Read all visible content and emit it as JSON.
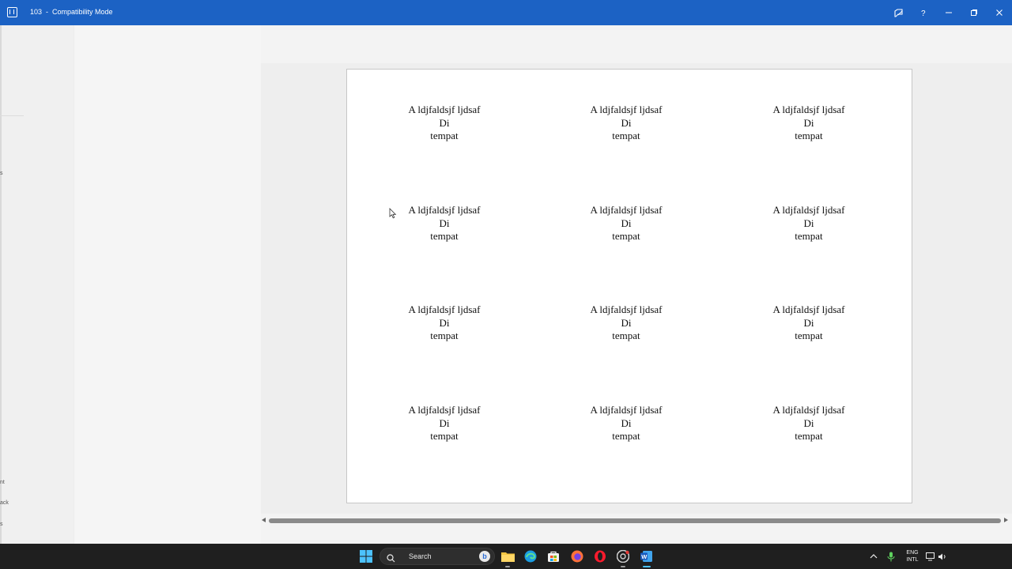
{
  "titlebar": {
    "doc_name": "103",
    "separator": "-",
    "mode": "Compatibility Mode",
    "colors": {
      "background": "#1c62c4"
    }
  },
  "left_panel": {
    "items": [
      "s",
      "nt",
      "ack",
      "s"
    ]
  },
  "document": {
    "labels": [
      {
        "line1": "A ldjfaldsjf ljdsaf",
        "line2": "Di",
        "line3": "tempat"
      },
      {
        "line1": "A ldjfaldsjf ljdsaf",
        "line2": "Di",
        "line3": "tempat"
      },
      {
        "line1": "A ldjfaldsjf ljdsaf",
        "line2": "Di",
        "line3": "tempat"
      },
      {
        "line1": "A ldjfaldsjf ljdsaf",
        "line2": "Di",
        "line3": "tempat"
      },
      {
        "line1": "A ldjfaldsjf ljdsaf",
        "line2": "Di",
        "line3": "tempat"
      },
      {
        "line1": "A ldjfaldsjf ljdsaf",
        "line2": "Di",
        "line3": "tempat"
      },
      {
        "line1": "A ldjfaldsjf ljdsaf",
        "line2": "Di",
        "line3": "tempat"
      },
      {
        "line1": "A ldjfaldsjf ljdsaf",
        "line2": "Di",
        "line3": "tempat"
      },
      {
        "line1": "A ldjfaldsjf ljdsaf",
        "line2": "Di",
        "line3": "tempat"
      },
      {
        "line1": "A ldjfaldsjf ljdsaf",
        "line2": "Di",
        "line3": "tempat"
      },
      {
        "line1": "A ldjfaldsjf ljdsaf",
        "line2": "Di",
        "line3": "tempat"
      },
      {
        "line1": "A ldjfaldsjf ljdsaf",
        "line2": "Di",
        "line3": "tempat"
      }
    ]
  },
  "taskbar": {
    "search_label": "Search",
    "tray_lang_1": "ENG",
    "tray_lang_2": "INTL",
    "icons": [
      "windows-start-icon",
      "search-icon",
      "file-explorer-icon",
      "edge-icon",
      "microsoft-store-icon",
      "firefox-icon",
      "opera-icon",
      "chrome-icon",
      "word-icon"
    ]
  }
}
